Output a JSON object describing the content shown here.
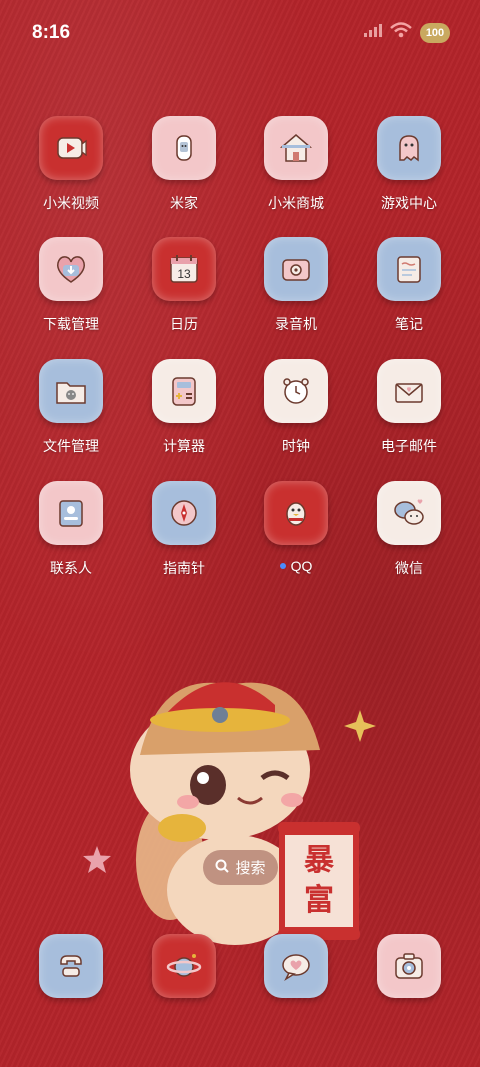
{
  "status_bar": {
    "time": "8:16",
    "battery": "100"
  },
  "apps": [
    {
      "label": "小米视频",
      "icon": "video-icon"
    },
    {
      "label": "米家",
      "icon": "smart-home-icon"
    },
    {
      "label": "小米商城",
      "icon": "store-icon"
    },
    {
      "label": "游戏中心",
      "icon": "game-ghost-icon"
    },
    {
      "label": "下载管理",
      "icon": "download-icon"
    },
    {
      "label": "日历",
      "icon": "calendar-icon",
      "calendar_day": "13"
    },
    {
      "label": "录音机",
      "icon": "recorder-icon"
    },
    {
      "label": "笔记",
      "icon": "notes-icon"
    },
    {
      "label": "文件管理",
      "icon": "folder-icon"
    },
    {
      "label": "计算器",
      "icon": "calculator-icon"
    },
    {
      "label": "时钟",
      "icon": "clock-icon"
    },
    {
      "label": "电子邮件",
      "icon": "mail-icon"
    },
    {
      "label": "联系人",
      "icon": "contacts-icon"
    },
    {
      "label": "指南针",
      "icon": "compass-icon"
    },
    {
      "label": "QQ",
      "icon": "qq-penguin-icon",
      "notification_dot": true
    },
    {
      "label": "微信",
      "icon": "wechat-icon"
    }
  ],
  "dock": [
    {
      "icon": "phone-icon"
    },
    {
      "icon": "browser-planet-icon"
    },
    {
      "icon": "messages-icon"
    },
    {
      "icon": "camera-icon"
    }
  ],
  "search": {
    "label": "搜索"
  },
  "mascot": {
    "banner_text": "暴富"
  }
}
